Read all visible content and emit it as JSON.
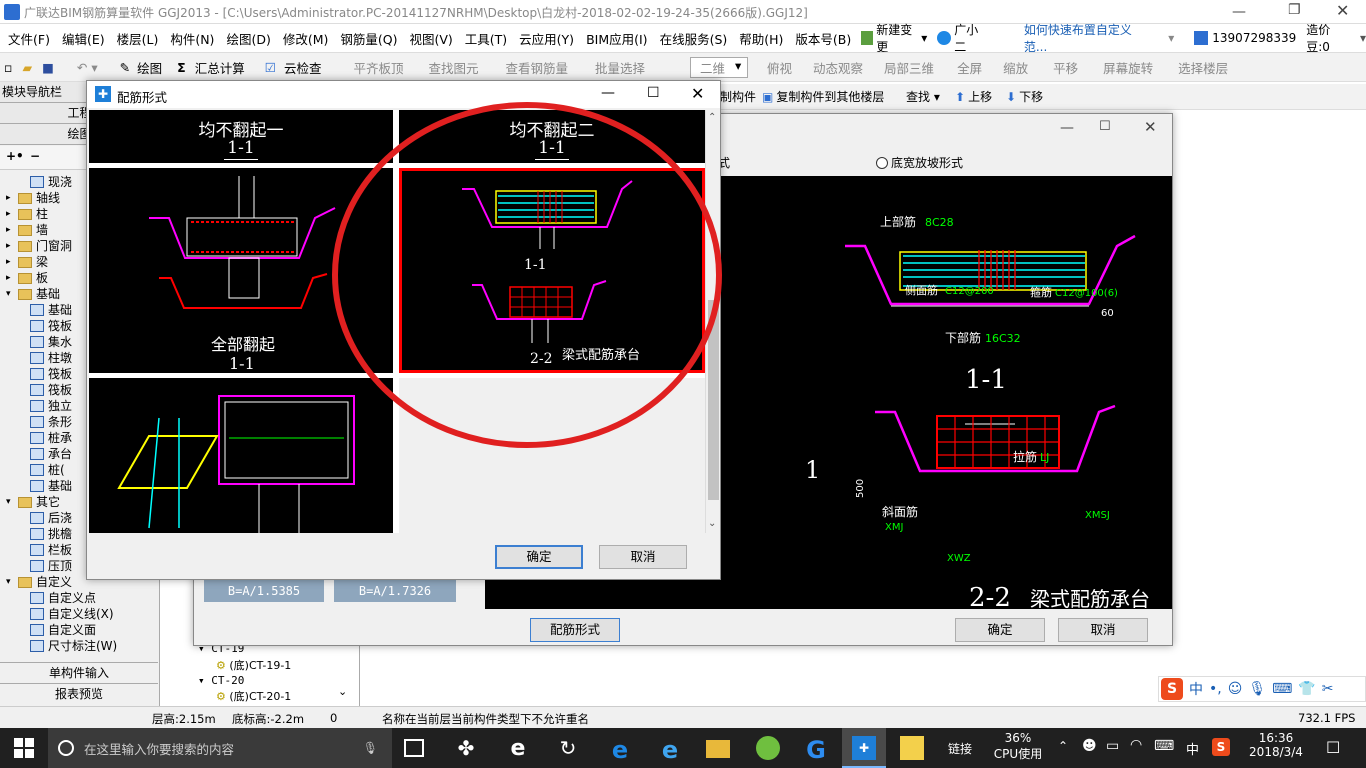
{
  "app": {
    "title": "广联达BIM钢筋算量软件 GGJ2013 - [C:\\Users\\Administrator.PC-20141127NRHM\\Desktop\\白龙村-2018-02-02-19-24-35(2666版).GGJ12]"
  },
  "menu": [
    "文件(F)",
    "编辑(E)",
    "楼层(L)",
    "构件(N)",
    "绘图(D)",
    "修改(M)",
    "钢筋量(Q)",
    "视图(V)",
    "工具(T)",
    "云应用(Y)",
    "BIM应用(I)",
    "在线服务(S)",
    "帮助(H)",
    "版本号(B)"
  ],
  "menu_right": {
    "new_change": "新建变更",
    "assistant": "广小二",
    "help_link": "如何快速布置自定义范...",
    "phone": "13907298339",
    "bean": "造价豆:0"
  },
  "toolbar": {
    "draw": "绘图",
    "sum": "汇总计算",
    "cloud_check": "云检查",
    "flush": "平齐板顶",
    "find": "查找图元",
    "view_qty": "查看钢筋量",
    "batch": "批量选择",
    "view_mode": "二维",
    "top_view": "俯视",
    "dynamic": "动态观察",
    "local3d": "局部三维",
    "fullscreen": "全屏",
    "zoom": "缩放",
    "pan": "平移",
    "rotate": "屏幕旋转",
    "select_floor": "选择楼层"
  },
  "toolbar2": {
    "member": "制构件",
    "copy_to_floor": "复制构件到其他楼层",
    "find": "查找",
    "up": "上移",
    "down": "下移"
  },
  "nav": {
    "title": "模块导航栏",
    "tab1": "工程",
    "tab2": "绘图",
    "tree": [
      "现浇",
      "轴线",
      "柱",
      "墙",
      "门窗洞",
      "梁",
      "板",
      "基础",
      "基础",
      "筏板",
      "集水",
      "柱墩",
      "筏板",
      "筏板",
      "独立",
      "条形",
      "桩承",
      "承台",
      "桩(",
      "基础",
      "其它",
      "后浇",
      "挑檐",
      "栏板",
      "压顶",
      "自定义",
      "自定义点",
      "自定义线(X)",
      "自定义面",
      "尺寸标注(W)"
    ],
    "single_input": "单构件输入",
    "report": "报表预览"
  },
  "dialog_small": {
    "title": "配筋形式",
    "options": [
      {
        "title": "均不翻起一",
        "sub": "1-1"
      },
      {
        "title": "均不翻起二",
        "sub": "1-1",
        "sub2": "1-1",
        "sub3": "2-2",
        "caption": "梁式配筋承台"
      },
      {
        "title": "全部翻起",
        "sub": "1-1"
      },
      {
        "title": ""
      }
    ],
    "ok": "确定",
    "cancel": "取消"
  },
  "dialog_big": {
    "radio_left": "形式",
    "radio_right": "底宽放坡形式",
    "b1": "B=A/1.5385",
    "b2": "B=A/1.7326",
    "rebar_form": "配筋形式",
    "ok": "确定",
    "cancel": "取消",
    "drawing": {
      "top_rebar": "上部筋",
      "top_val": "8C28",
      "side_rebar": "侧面筋",
      "side_val": "C12@200",
      "stirrup": "箍筋",
      "stirrup_val": "C12@100(6)",
      "bottom_rebar": "下部筋",
      "bottom_val": "16C32",
      "sec1": "1-1",
      "tie": "拉筋",
      "tie_val": "LJ",
      "slope": "斜面筋",
      "xmj": "XMJ",
      "xmsj": "XMSJ",
      "xwz": "XWZ",
      "sec2": "2-2",
      "caption": "梁式配筋承台",
      "label_1": "1",
      "dim500": "500",
      "dim60": "60"
    }
  },
  "component_tree": [
    "CT-19",
    "(底)CT-19-1",
    "CT-20",
    "(底)CT-20-1"
  ],
  "status": {
    "floor_h": "层高:2.15m",
    "base_h": "底标高:-2.2m",
    "zero": "0",
    "msg": "名称在当前层当前构件类型下不允许重名",
    "fps": "732.1 FPS"
  },
  "taskbar": {
    "search": "在这里输入你要搜索的内容",
    "link": "链接",
    "cpu_pct": "36%",
    "cpu_label": "CPU使用",
    "ime": "中",
    "time": "16:36",
    "date": "2018/3/4"
  },
  "colors": {
    "red": "#ff0000",
    "magenta": "#ff00ff",
    "yellow": "#ffff00",
    "green": "#00ff00",
    "cyan": "#00ffff"
  }
}
